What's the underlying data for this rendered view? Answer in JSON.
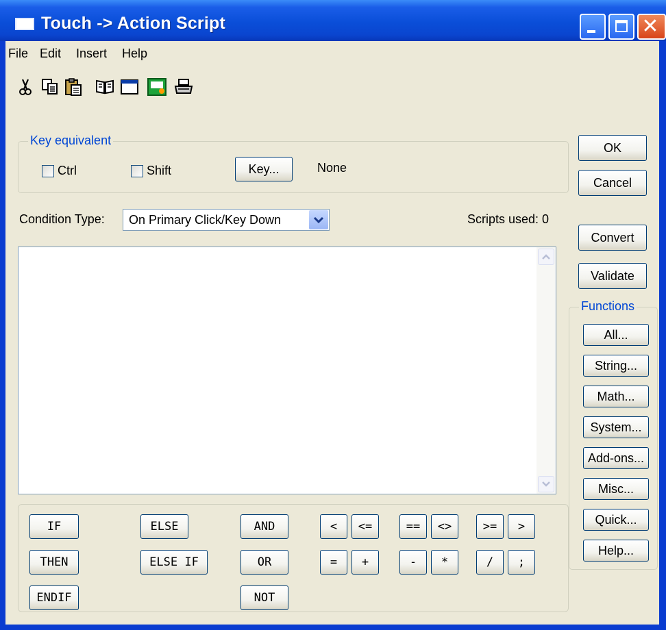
{
  "window": {
    "title": "Touch -> Action Script",
    "minimize_icon": "minimize-icon",
    "maximize_icon": "maximize-icon",
    "close_icon": "close-icon",
    "close_glyph": "✕"
  },
  "menu": [
    "File",
    "Edit",
    "Insert",
    "Help"
  ],
  "toolbar": [
    "cut-icon",
    "copy-icon",
    "paste-icon",
    "book-icon",
    "window-icon",
    "dde-icon",
    "print-icon"
  ],
  "key_equivalent": {
    "legend": "Key equivalent",
    "ctrl_label": "Ctrl",
    "shift_label": "Shift",
    "key_button": "Key...",
    "key_value": "None"
  },
  "condition": {
    "label": "Condition Type:",
    "value": "On Primary Click/Key Down",
    "scripts_used": "Scripts used: 0"
  },
  "editor": {
    "content": ""
  },
  "right_buttons": {
    "ok": "OK",
    "cancel": "Cancel",
    "convert": "Convert",
    "validate": "Validate"
  },
  "functions": {
    "legend": "Functions",
    "buttons": [
      "All...",
      "String...",
      "Math...",
      "System...",
      "Add-ons...",
      "Misc...",
      "Quick...",
      "Help..."
    ]
  },
  "operators": {
    "if": "IF",
    "then": "THEN",
    "endif": "ENDIF",
    "else": "ELSE",
    "else_if": "ELSE IF",
    "and": "AND",
    "or": "OR",
    "not": "NOT",
    "lt": "<",
    "le": "<=",
    "eqeq": "==",
    "ne": "<>",
    "ge": ">=",
    "gt": ">",
    "assign": "=",
    "plus": "+",
    "minus": "-",
    "times": "*",
    "divide": "/",
    "semicolon": ";"
  },
  "colors": {
    "titlebar": "#0a4ed8",
    "dialog_bg": "#ece9d8",
    "groupbox_label": "#0046d5",
    "button_border": "#003c74"
  }
}
